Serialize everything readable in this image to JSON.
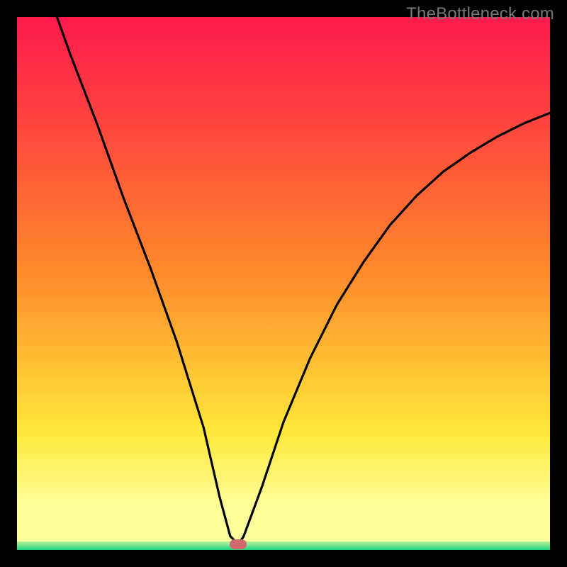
{
  "watermark": {
    "text": "TheBottleneck.com"
  },
  "chart_data": {
    "type": "line",
    "title": "",
    "xlabel": "",
    "ylabel": "",
    "xlim": [
      0,
      100
    ],
    "ylim": [
      0,
      100
    ],
    "grid": false,
    "legend": false,
    "gradient_colors": {
      "top": "#ff1a4c",
      "mid_red": "#ff4040",
      "orange": "#ff8a2a",
      "yellow": "#ffe83a",
      "pale_yellow": "#ffff9c",
      "green_band_top": "#b9f39a",
      "green_band_mid": "#6de28a",
      "green_band_bottom": "#18d67e"
    },
    "series": [
      {
        "name": "bottleneck-curve",
        "color": "#000000",
        "x": [
          7.5,
          10,
          15,
          20,
          25,
          30,
          35,
          38,
          40,
          41.5,
          42.5,
          46,
          50,
          55,
          60,
          65,
          70,
          75,
          80,
          85,
          90,
          95,
          100
        ],
        "y": [
          100,
          93,
          80,
          66,
          53,
          39,
          23,
          10,
          2.6,
          1.1,
          2.5,
          12,
          24,
          36,
          46,
          54,
          61,
          66.5,
          71,
          74.5,
          77.5,
          80,
          82
        ]
      }
    ],
    "optimal_marker": {
      "x": 41.5,
      "y": 1.0,
      "color": "#d16a6e"
    },
    "green_band_height_fraction_from_bottom": 0.016
  },
  "icons": {}
}
